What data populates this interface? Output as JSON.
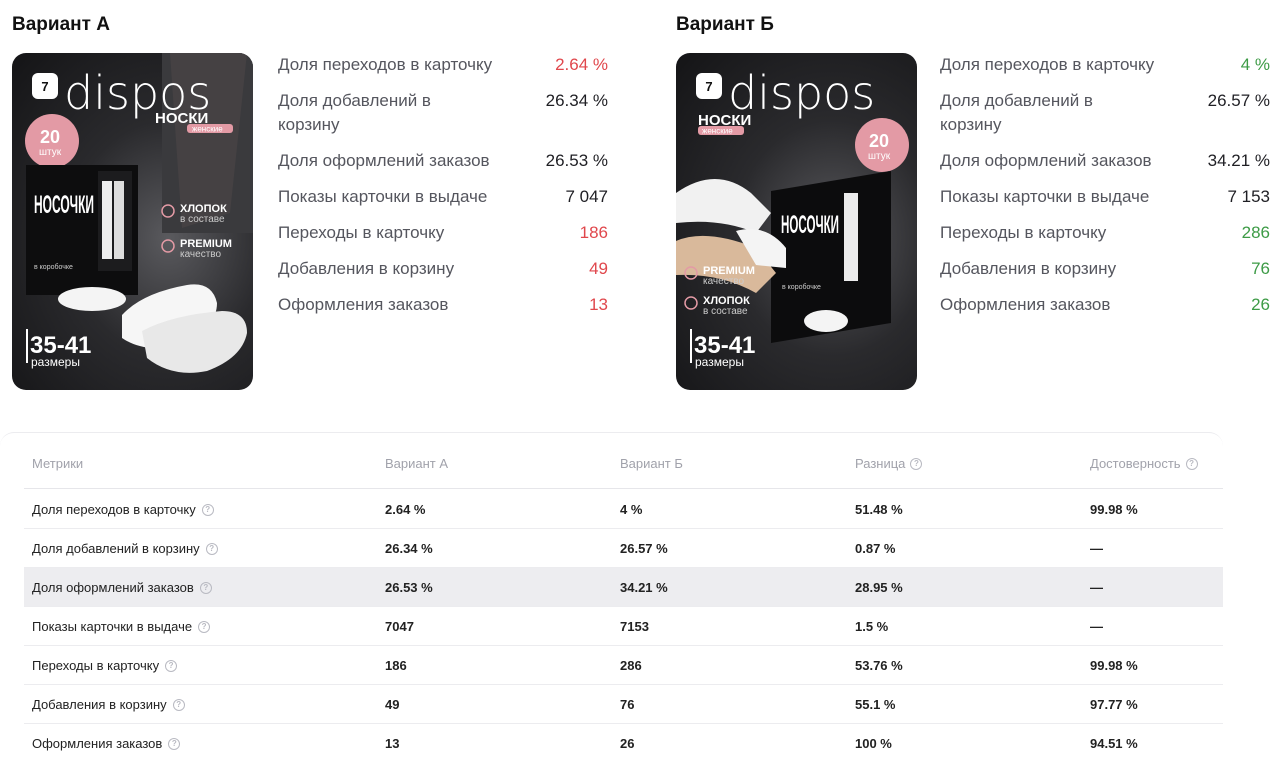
{
  "variant_a": {
    "title": "Вариант А",
    "image": {
      "badge": "7",
      "brand": "dispos",
      "product_word": "НОСКИ",
      "product_sub": "женские",
      "count_big": "20",
      "count_unit": "штук",
      "box_word": "НОСОЧКИ",
      "box_sub": "в коробочке",
      "feature1_big": "ХЛОПОК",
      "feature1_small": "в составе",
      "feature2_big": "PREMIUM",
      "feature2_small": "качество",
      "size": "35-41",
      "size_label": "размеры"
    },
    "metrics": [
      {
        "label": "Доля переходов в карточку",
        "value": "2.64 %",
        "tone": "red"
      },
      {
        "label": "Доля добавлений в корзину",
        "value": "26.34 %",
        "tone": "neutral"
      },
      {
        "label": "Доля оформлений заказов",
        "value": "26.53 %",
        "tone": "neutral"
      },
      {
        "label": "Показы карточки в выдаче",
        "value": "7 047",
        "tone": "neutral"
      },
      {
        "label": "Переходы в карточку",
        "value": "186",
        "tone": "red"
      },
      {
        "label": "Добавления в корзину",
        "value": "49",
        "tone": "red"
      },
      {
        "label": "Оформления заказов",
        "value": "13",
        "tone": "red"
      }
    ]
  },
  "variant_b": {
    "title": "Вариант Б",
    "image": {
      "badge": "7",
      "brand": "dispos",
      "product_word": "НОСКИ",
      "product_sub": "женские",
      "count_big": "20",
      "count_unit": "штук",
      "box_word": "НОСОЧКИ",
      "box_sub": "в коробочке",
      "feature1_big": "PREMIUM",
      "feature1_small": "качество",
      "feature2_big": "ХЛОПОК",
      "feature2_small": "в составе",
      "size": "35-41",
      "size_label": "размеры"
    },
    "metrics": [
      {
        "label": "Доля переходов в карточку",
        "value": "4 %",
        "tone": "green"
      },
      {
        "label": "Доля добавлений в корзину",
        "value": "26.57 %",
        "tone": "neutral"
      },
      {
        "label": "Доля оформлений заказов",
        "value": "34.21 %",
        "tone": "neutral"
      },
      {
        "label": "Показы карточки в выдаче",
        "value": "7 153",
        "tone": "neutral"
      },
      {
        "label": "Переходы в карточку",
        "value": "286",
        "tone": "green"
      },
      {
        "label": "Добавления в корзину",
        "value": "76",
        "tone": "green"
      },
      {
        "label": "Оформления заказов",
        "value": "26",
        "tone": "green"
      }
    ]
  },
  "table": {
    "headers": [
      "Метрики",
      "Вариант А",
      "Вариант Б",
      "Разница",
      "Достоверность"
    ],
    "rows": [
      {
        "metric": "Доля переходов в карточку",
        "a": "2.64 %",
        "b": "4 %",
        "diff": "51.48 %",
        "conf": "99.98 %"
      },
      {
        "metric": "Доля добавлений в корзину",
        "a": "26.34 %",
        "b": "26.57 %",
        "diff": "0.87 %",
        "conf": "—"
      },
      {
        "metric": "Доля оформлений заказов",
        "a": "26.53 %",
        "b": "34.21 %",
        "diff": "28.95 %",
        "conf": "—"
      },
      {
        "metric": "Показы карточки в выдаче",
        "a": "7047",
        "b": "7153",
        "diff": "1.5 %",
        "conf": "—"
      },
      {
        "metric": "Переходы в карточку",
        "a": "186",
        "b": "286",
        "diff": "53.76 %",
        "conf": "99.98 %"
      },
      {
        "metric": "Добавления в корзину",
        "a": "49",
        "b": "76",
        "diff": "55.1 %",
        "conf": "97.77 %"
      },
      {
        "metric": "Оформления заказов",
        "a": "13",
        "b": "26",
        "diff": "100 %",
        "conf": "94.51 %"
      }
    ],
    "highlighted_row": 2
  },
  "colors": {
    "red": "#e0474c",
    "green": "#3d9b46",
    "pink_badge": "#e39aa5"
  },
  "icons": {
    "help": "question-circle-icon"
  }
}
